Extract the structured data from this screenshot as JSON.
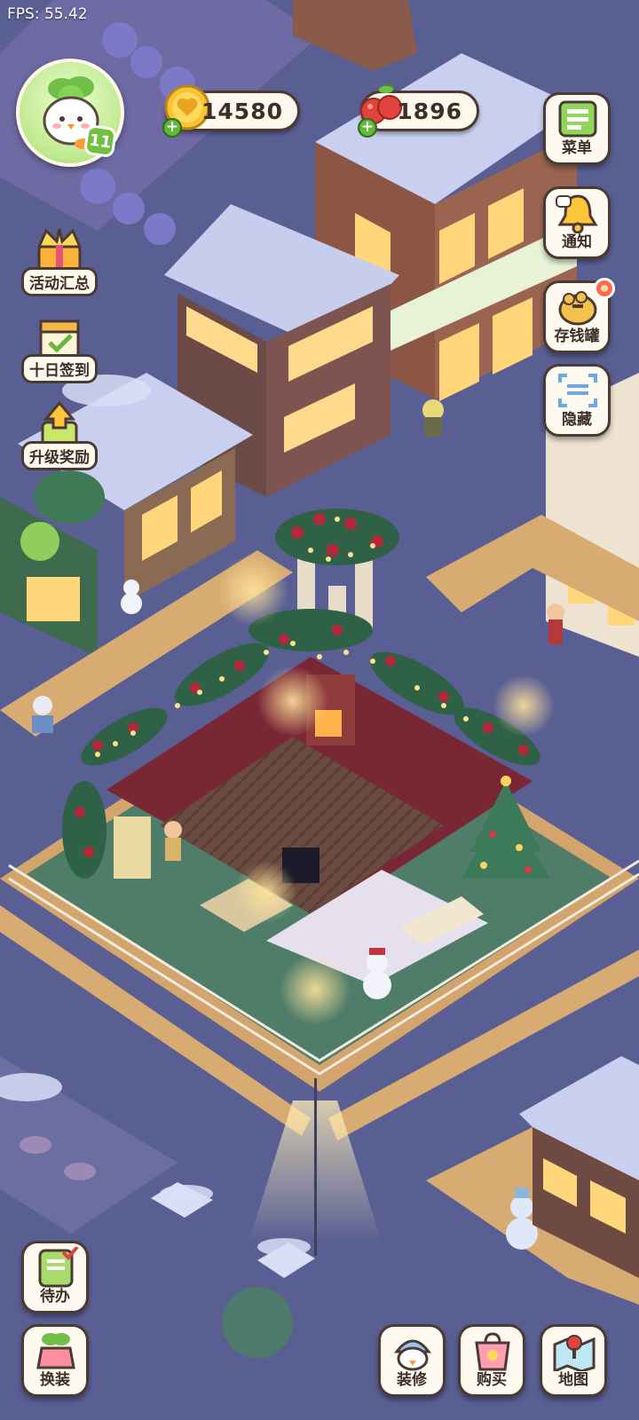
{
  "hud": {
    "fps_label": "FPS: 55.42",
    "player_level": "11",
    "coins": "14580",
    "fruits": "1896"
  },
  "left_buttons": {
    "events": "活动汇总",
    "checkin": "十日签到",
    "levelup": "升级奖励"
  },
  "right_buttons": {
    "menu": "菜单",
    "notice": "通知",
    "piggy": "存钱罐",
    "hide": "隐藏"
  },
  "bottom_buttons": {
    "todo": "待办",
    "outfit": "换装",
    "decorate": "装修",
    "shop": "购买",
    "map": "地图"
  },
  "icons": {
    "avatar": "sprout-mascot-avatar",
    "coin": "heart-coin-icon",
    "fruit": "cherry-fruit-icon",
    "events": "crown-gift-icon",
    "checkin": "calendar-check-icon",
    "levelup": "arrow-up-gift-icon",
    "menu": "notebook-menu-icon",
    "notice": "bell-icon",
    "piggy": "piggy-bank-icon",
    "hide": "eye-scan-icon",
    "todo": "clipboard-check-icon",
    "outfit": "clothes-icon",
    "decorate": "duck-helmet-icon",
    "shop": "shopping-bag-icon",
    "map": "map-pin-icon"
  },
  "colors": {
    "ground": "#5a5f93",
    "road": "#6b6fa3",
    "sidewalk": "#e5b97c",
    "snow": "#d9def6",
    "garden_carpet": "#7a2735",
    "hedge": "#2f6146",
    "lights": "#ffd27a",
    "button_fill": "#fffaf0",
    "button_outline": "#4a3a33"
  }
}
